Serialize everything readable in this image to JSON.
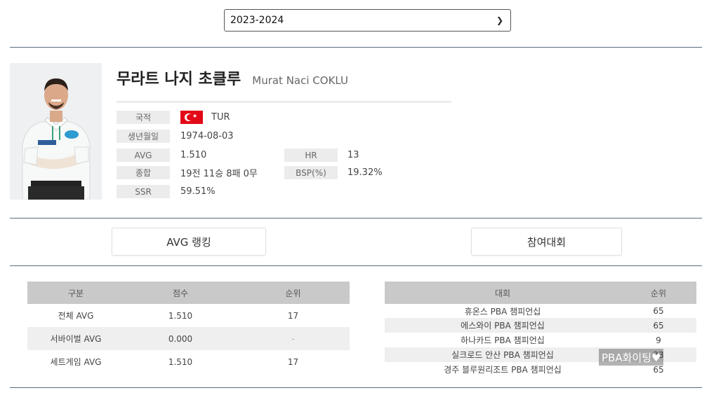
{
  "season": {
    "selected": "2023-2024"
  },
  "player": {
    "name_ko": "무라트 나지 초클루",
    "name_en": "Murat Naci COKLU",
    "info": {
      "nationality_label": "국적",
      "nationality_value": "TUR",
      "birth_label": "생년월일",
      "birth_value": "1974-08-03",
      "avg_label": "AVG",
      "avg_value": "1.510",
      "hr_label": "HR",
      "hr_value": "13",
      "record_label": "종합",
      "record_value": "19전 11승 8패 0무",
      "bsp_label": "BSP(%)",
      "bsp_value": "19.32%",
      "ssr_label": "SSR",
      "ssr_value": "59.51%"
    }
  },
  "tabs": {
    "avg_ranking": "AVG 랭킹",
    "tournaments": "참여대회"
  },
  "avg_table": {
    "headers": [
      "구분",
      "점수",
      "순위"
    ],
    "rows": [
      [
        "전체 AVG",
        "1.510",
        "17"
      ],
      [
        "서바이벌 AVG",
        "0.000",
        "-"
      ],
      [
        "세트게임 AVG",
        "1.510",
        "17"
      ]
    ]
  },
  "tournament_table": {
    "headers": [
      "대회",
      "순위"
    ],
    "rows": [
      [
        "휴온스 PBA 챔피언십",
        "65"
      ],
      [
        "에스와이 PBA 챔피언십",
        "65"
      ],
      [
        "하나카드 PBA 챔피언십",
        "9"
      ],
      [
        "실크로드 안산 PBA 챔피언십",
        "33"
      ],
      [
        "경주 블루원리조트 PBA 챔피언십",
        "65"
      ]
    ]
  },
  "watermark": "PBA화이팅♥",
  "colors": {
    "table_header": "#c9c9c9",
    "divider": "#5a6a7e",
    "flag_red": "#e30a17"
  }
}
